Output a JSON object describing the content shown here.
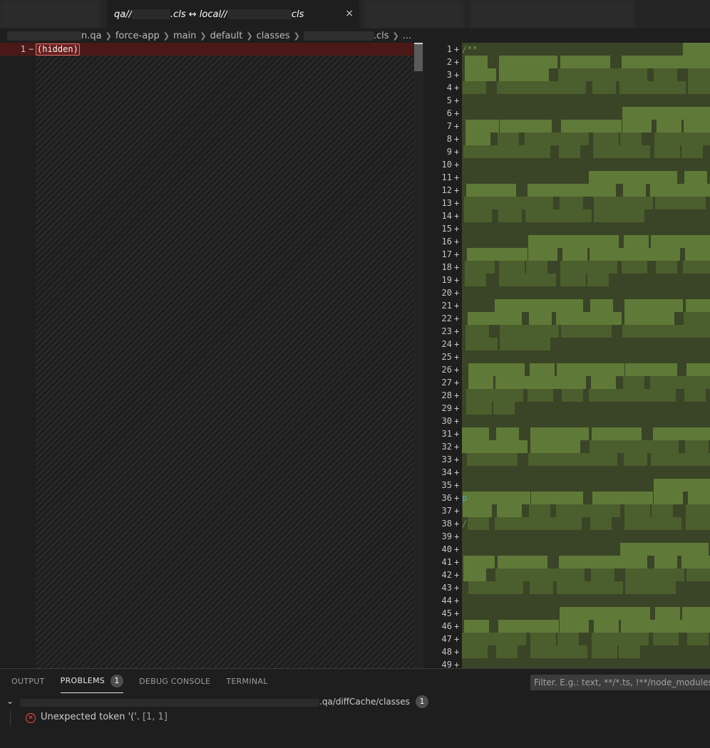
{
  "tab": {
    "title_prefix": "qa//",
    "title_mid": ".cls ↔ local//",
    "title_suffix": "cls",
    "close_glyph": "×"
  },
  "breadcrumb": {
    "items": [
      "n.qa",
      "force-app",
      "main",
      "default",
      "classes",
      ".cls",
      "..."
    ]
  },
  "left_editor": {
    "line_number": "1",
    "marker": "−",
    "code": "(hidden)"
  },
  "right_editor": {
    "marker": "+",
    "first_line_code": "/**",
    "line_36_prefix": "p",
    "line_38_prefix": "/",
    "line_count": 49,
    "colors": {
      "added_bg": "#4b5e2d",
      "added_dark": "#3a4426",
      "added_light": "#5f7a38"
    }
  },
  "panel": {
    "tabs": {
      "output": "OUTPUT",
      "problems": "PROBLEMS",
      "problems_count": "1",
      "debug_console": "DEBUG CONSOLE",
      "terminal": "TERMINAL"
    },
    "filter_placeholder": "Filter. E.g.: text, **/*.ts, !**/node_modules/**",
    "group": {
      "label": ".qa/diffCache/classes",
      "count": "1"
    },
    "problem": {
      "message": "Unexpected token '('.",
      "position": "[1, 1]"
    }
  }
}
